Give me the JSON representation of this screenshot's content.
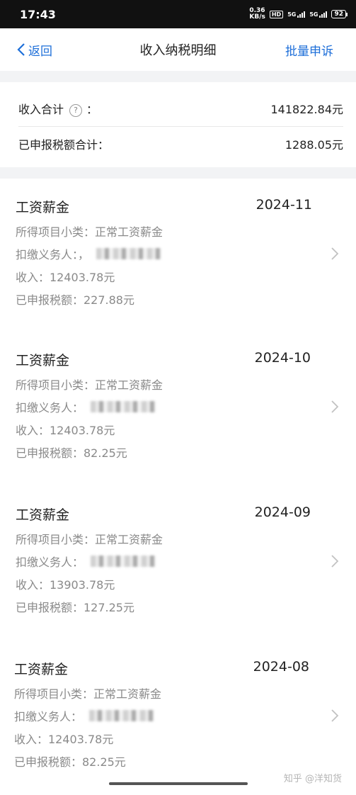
{
  "status_bar": {
    "time": "17:43",
    "net_speed_value": "0.36",
    "net_speed_unit": "KB/s",
    "hd": "HD",
    "signal1": "5G",
    "signal2": "5G",
    "battery": "92"
  },
  "nav": {
    "back_label": "返回",
    "title": "收入纳税明细",
    "action_label": "批量申诉"
  },
  "summary": {
    "income_label": "收入合计",
    "income_colon": "：",
    "income_value": "141822.84元",
    "tax_label": "已申报税额合计：",
    "tax_value": "1288.05元"
  },
  "records": [
    {
      "title": "工资薪金",
      "date": "2024-11",
      "subcategory": "所得项目小类：正常工资薪金",
      "withholder_label": "扣缴义务人：，",
      "income": "收入：12403.78元",
      "tax": "已申报税额：227.88元"
    },
    {
      "title": "工资薪金",
      "date": "2024-10",
      "subcategory": "所得项目小类：正常工资薪金",
      "withholder_label": "扣缴义务人：",
      "income": "收入：12403.78元",
      "tax": "已申报税额：82.25元"
    },
    {
      "title": "工资薪金",
      "date": "2024-09",
      "subcategory": "所得项目小类：正常工资薪金",
      "withholder_label": "扣缴义务人：",
      "income": "收入：13903.78元",
      "tax": "已申报税额：127.25元"
    },
    {
      "title": "工资薪金",
      "date": "2024-08",
      "subcategory": "所得项目小类：正常工资薪金",
      "withholder_label": "扣缴义务人：",
      "income": "收入：12403.78元",
      "tax": "已申报税额：82.25元"
    }
  ],
  "watermark": "知乎 @洋知货",
  "colors": {
    "accent": "#1e6fd9",
    "secondary_text": "#8a8a8a",
    "divider_bg": "#f2f3f5"
  },
  "icons": [
    "chevron-left-icon",
    "question-mark-icon",
    "chevron-right-icon"
  ]
}
